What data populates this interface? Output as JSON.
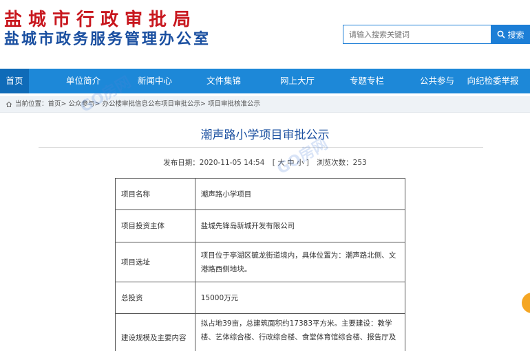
{
  "header": {
    "title_main": "盐城市行政审批局",
    "title_sub": "盐城市政务服务管理办公室"
  },
  "search": {
    "placeholder": "请输入搜索关键词",
    "button_label": "搜索"
  },
  "nav": {
    "items": [
      {
        "label": "首页",
        "active": true
      },
      {
        "label": "单位简介"
      },
      {
        "label": "新闻中心"
      },
      {
        "label": "文件集锦"
      },
      {
        "label": "网上大厅"
      },
      {
        "label": "专题专栏"
      },
      {
        "label": "公共参与"
      },
      {
        "label": "向纪检委举报"
      }
    ]
  },
  "breadcrumb": {
    "prefix": "当前位置：",
    "path": "首页> 公众参与> 办公楼审批信息公布项目审批公示> 项目审批核准公示"
  },
  "article": {
    "title": "潮声路小学项目审批公示",
    "publish_label": "发布日期：",
    "publish_date": "2020-11-05 14:54",
    "font_size": "[ 大 中 小 ]",
    "views_label": "浏览次数：",
    "views": "253"
  },
  "table": {
    "rows": [
      {
        "label": "项目名称",
        "value": "潮声路小学项目"
      },
      {
        "label": "项目投资主体",
        "value": "盐城先锋岛新城开发有限公司"
      },
      {
        "label": "项目选址",
        "value": "项目位于亭湖区毓龙街道境内，具体位置为：潮声路北侧、文港路西侧地块。"
      },
      {
        "label": "总投资",
        "value": "15000万元"
      },
      {
        "label": "建设规模及主要内容",
        "value": "拟占地39亩，总建筑面积约17383平方米。主要建设：教学楼、艺体综合楼、行政综合楼、食堂体育馆综合楼、报告厅及"
      }
    ]
  },
  "watermark": {
    "text": "GO房网"
  },
  "colors": {
    "brand_red": "#c8171e",
    "brand_blue": "#1a4fa0",
    "nav_blue": "#1d88d8",
    "nav_active": "#0f6bb8"
  }
}
